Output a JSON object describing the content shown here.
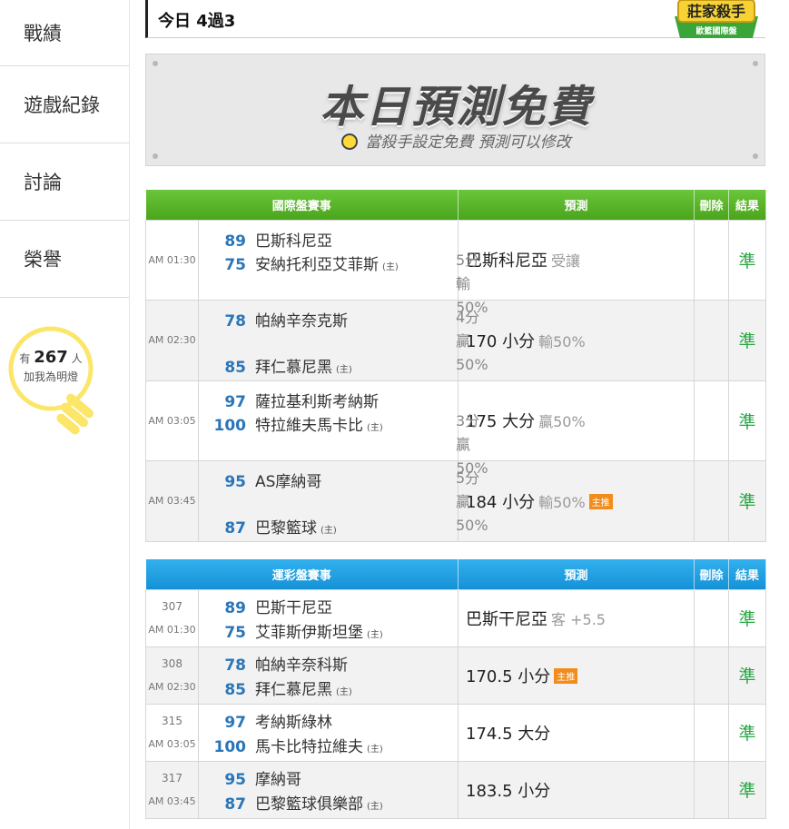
{
  "sidebar": {
    "items": [
      {
        "label": "戰績"
      },
      {
        "label": "遊戲紀錄"
      },
      {
        "label": "討論"
      },
      {
        "label": "榮譽"
      }
    ],
    "bulb": {
      "prefix": "有",
      "count": "267",
      "suffix": "人",
      "caption": "加我為明燈"
    }
  },
  "header": {
    "today_text": "今日 4過3",
    "badge": {
      "title": "莊家殺手",
      "subtitle": "歐籃國際盤"
    }
  },
  "banner": {
    "title": "本日預測免費",
    "subtitle": "當殺手設定免費 預測可以修改"
  },
  "intl_table": {
    "headers": [
      "國際盤賽事",
      "預測",
      "刪除",
      "結果"
    ],
    "rows": [
      {
        "time": "AM 01:30",
        "away_score": "89",
        "away": "巴斯科尼亞",
        "home_score": "75",
        "home": "安納托利亞艾菲斯",
        "home_mark": "(主)",
        "spread1": "5分輸",
        "spread2": "50%",
        "pred_main": "巴斯科尼亞",
        "pred_odds": "受讓",
        "pred_tag": "",
        "result": "準"
      },
      {
        "time": "AM 02:30",
        "away_score": "78",
        "away": "帕納辛奈克斯",
        "home_score": "85",
        "home": "拜仁慕尼黑",
        "home_mark": "(主)",
        "spread1": "4分贏",
        "spread2": "50%",
        "pred_main": "170 小分",
        "pred_odds": "輸50%",
        "pred_tag": "",
        "result": "準"
      },
      {
        "time": "AM 03:05",
        "away_score": "97",
        "away": "薩拉基利斯考納斯",
        "home_score": "100",
        "home": "特拉維夫馬卡比",
        "home_mark": "(主)",
        "spread1": "3分贏",
        "spread2": "50%",
        "pred_main": "175 大分",
        "pred_odds": "贏50%",
        "pred_tag": "",
        "result": "準"
      },
      {
        "time": "AM 03:45",
        "away_score": "95",
        "away": "AS摩納哥",
        "home_score": "87",
        "home": "巴黎籃球",
        "home_mark": "(主)",
        "spread1": "5分贏",
        "spread2": "50%",
        "pred_main": "184 小分",
        "pred_odds": "輸50%",
        "pred_tag": "主推",
        "result": "準"
      }
    ]
  },
  "lottery_table": {
    "headers": [
      "運彩盤賽事",
      "預測",
      "刪除",
      "結果"
    ],
    "rows": [
      {
        "num": "307",
        "time": "AM 01:30",
        "away_score": "89",
        "away": "巴斯干尼亞",
        "home_score": "75",
        "home": "艾菲斯伊斯坦堡",
        "home_mark": "(主)",
        "pred_main": "巴斯干尼亞",
        "pred_odds": "客 +5.5",
        "pred_tag": "",
        "result": "準"
      },
      {
        "num": "308",
        "time": "AM 02:30",
        "away_score": "78",
        "away": "帕納辛奈科斯",
        "home_score": "85",
        "home": "拜仁慕尼黑",
        "home_mark": "(主)",
        "pred_main": "170.5 小分",
        "pred_odds": "",
        "pred_tag": "主推",
        "result": "準"
      },
      {
        "num": "315",
        "time": "AM 03:05",
        "away_score": "97",
        "away": "考納斯綠林",
        "home_score": "100",
        "home": "馬卡比特拉維夫",
        "home_mark": "(主)",
        "pred_main": "174.5 大分",
        "pred_odds": "",
        "pred_tag": "",
        "result": "準"
      },
      {
        "num": "317",
        "time": "AM 03:45",
        "away_score": "95",
        "away": "摩納哥",
        "home_score": "87",
        "home": "巴黎籃球俱樂部",
        "home_mark": "(主)",
        "pred_main": "183.5 小分",
        "pred_odds": "",
        "pred_tag": "",
        "result": "準"
      }
    ]
  },
  "colors": {
    "result": "#28a745",
    "intl_header": "#55b025",
    "lottery_header": "#1c9be0",
    "score": "#2a76b8",
    "tag": "#f28c1b"
  }
}
